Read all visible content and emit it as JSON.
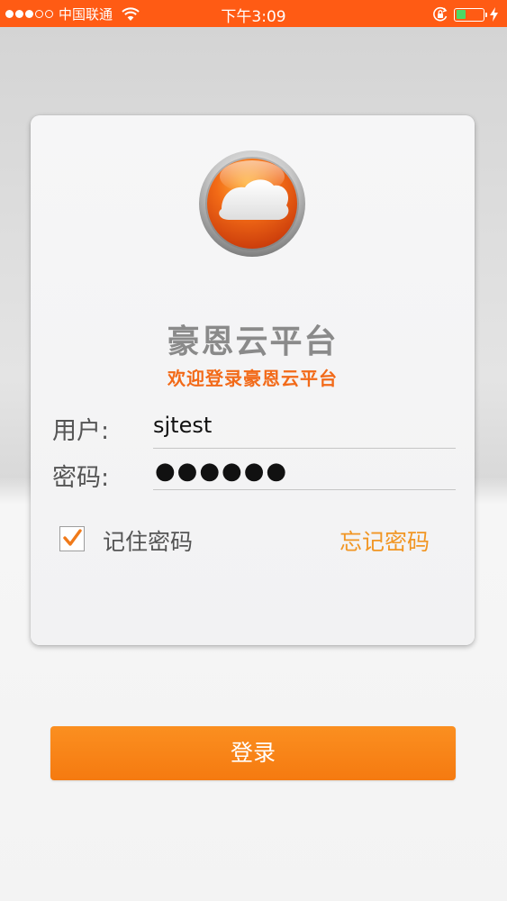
{
  "status_bar": {
    "carrier": "中国联通",
    "time": "下午3:09",
    "battery_level": 0.35,
    "signal_bars_filled": 3,
    "signal_bars_total": 5
  },
  "login_card": {
    "title": "豪恩云平台",
    "subtitle": "欢迎登录豪恩云平台",
    "username_label": "用户:",
    "username_value": "sjtest",
    "password_label": "密码:",
    "password_masked": "●●●●●●",
    "remember_label": "记住密码",
    "remember_checked": true,
    "forgot_label": "忘记密码"
  },
  "login_button": {
    "label": "登录"
  },
  "colors": {
    "accent": "#ff5b14",
    "button": "#f7821a",
    "subtitle": "#f26a19",
    "forgot": "#f19624",
    "battery": "#4cd964"
  },
  "icons": {
    "logo": "cloud-logo-icon",
    "wifi": "wifi-icon",
    "rotation_lock": "rotation-lock-icon",
    "charging": "charging-bolt-icon",
    "check": "checkmark-icon"
  }
}
